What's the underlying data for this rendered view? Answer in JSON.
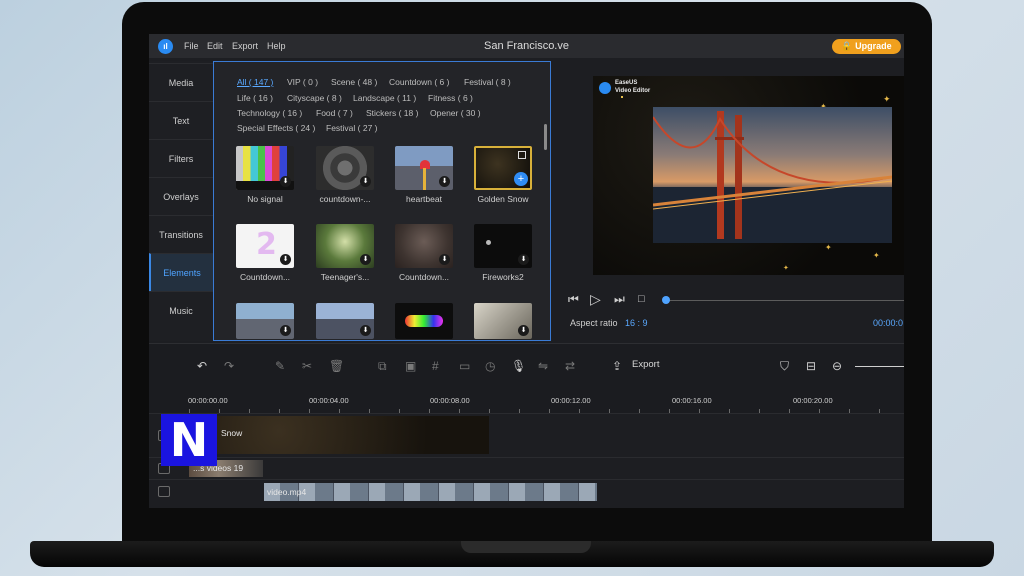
{
  "app": {
    "logo_text": "ıl",
    "menu": [
      "File",
      "Edit",
      "Export",
      "Help"
    ],
    "title": "San Francisco.ve",
    "upgrade_label": "🔒 Upgrade"
  },
  "sidebar": {
    "items": [
      {
        "label": "Media"
      },
      {
        "label": "Text"
      },
      {
        "label": "Filters"
      },
      {
        "label": "Overlays"
      },
      {
        "label": "Transitions"
      },
      {
        "label": "Elements",
        "active": true
      },
      {
        "label": "Music"
      }
    ]
  },
  "library": {
    "categories": [
      "All ( 147 )",
      "VIP ( 0 )",
      "Scene ( 48 )",
      "Countdown ( 6 )",
      "Festival ( 8 )",
      "Life ( 16 )",
      "Cityscape ( 8 )",
      "Landscape ( 11 )",
      "Fitness ( 6 )",
      "Technology ( 16 )",
      "Food ( 7 )",
      "Stickers ( 18 )",
      "Opener ( 30 )",
      "Special Effects ( 24 )",
      "Festival ( 27 )"
    ],
    "items": [
      {
        "label": "No signal"
      },
      {
        "label": "countdown-..."
      },
      {
        "label": "heartbeat"
      },
      {
        "label": "Golden Snow",
        "selected": true
      },
      {
        "label": "Countdown..."
      },
      {
        "label": "Teenager's..."
      },
      {
        "label": "Countdown..."
      },
      {
        "label": "Fireworks2"
      },
      {
        "label": ""
      },
      {
        "label": ""
      },
      {
        "label": ""
      },
      {
        "label": ""
      }
    ]
  },
  "preview": {
    "watermark_line1": "EaseUS",
    "watermark_line2": "Video Editor"
  },
  "player": {
    "aspect_label": "Aspect ratio",
    "aspect_value": "16 : 9",
    "time": "00:00:0"
  },
  "toolbar": {
    "export_label": "Export"
  },
  "timeline": {
    "ruler": [
      "00:00:00.00",
      "00:00:04.00",
      "00:00:08.00",
      "00:00:12.00",
      "00:00:16.00",
      "00:00:20.00"
    ],
    "tracks": [
      {
        "label": "Snow"
      },
      {
        "label": "...s videos 19"
      },
      {
        "label": "video.mp4"
      }
    ],
    "overlay_badge": "N"
  },
  "colors": {
    "accent": "#3a88e6",
    "upgrade": "#f0a01e",
    "panel": "#1d1e22"
  }
}
